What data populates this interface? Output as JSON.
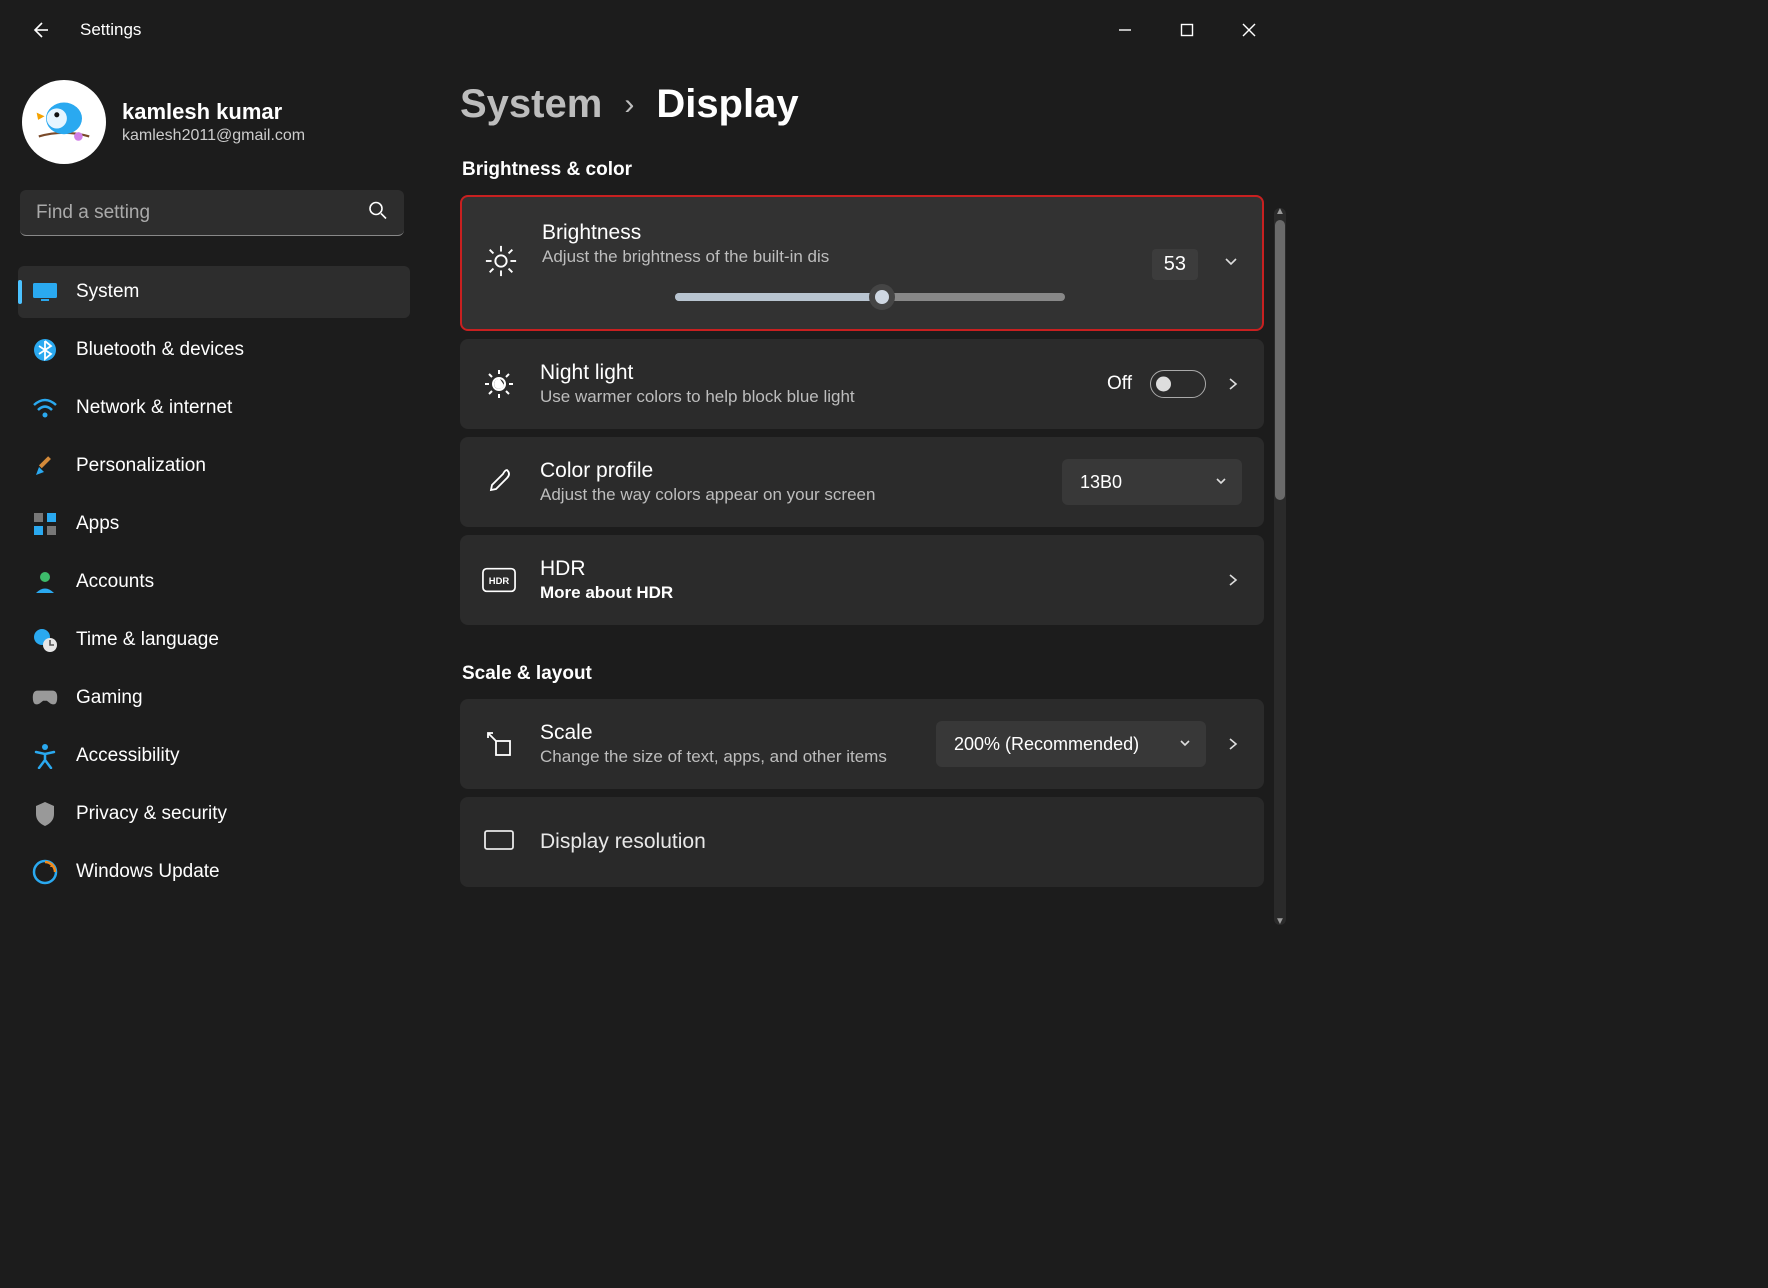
{
  "title": "Settings",
  "user": {
    "name": "kamlesh kumar",
    "email": "kamlesh2011@gmail.com"
  },
  "search": {
    "placeholder": "Find a setting"
  },
  "nav": {
    "items": [
      {
        "label": "System"
      },
      {
        "label": "Bluetooth & devices"
      },
      {
        "label": "Network & internet"
      },
      {
        "label": "Personalization"
      },
      {
        "label": "Apps"
      },
      {
        "label": "Accounts"
      },
      {
        "label": "Time & language"
      },
      {
        "label": "Gaming"
      },
      {
        "label": "Accessibility"
      },
      {
        "label": "Privacy & security"
      },
      {
        "label": "Windows Update"
      }
    ],
    "active_index": 0
  },
  "breadcrumb": {
    "parent": "System",
    "current": "Display"
  },
  "sections": {
    "brightness_color": {
      "title": "Brightness & color",
      "brightness": {
        "title": "Brightness",
        "sub": "Adjust the brightness of the built-in dis",
        "value": "53"
      },
      "night_light": {
        "title": "Night light",
        "sub": "Use warmer colors to help block blue light",
        "toggle_label": "Off"
      },
      "color_profile": {
        "title": "Color profile",
        "sub": "Adjust the way colors appear on your screen",
        "selected": "13B0"
      },
      "hdr": {
        "title": "HDR",
        "sub": "More about HDR"
      }
    },
    "scale_layout": {
      "title": "Scale & layout",
      "scale": {
        "title": "Scale",
        "sub": "Change the size of text, apps, and other items",
        "selected": "200% (Recommended)"
      },
      "resolution": {
        "title": "Display resolution"
      }
    }
  }
}
